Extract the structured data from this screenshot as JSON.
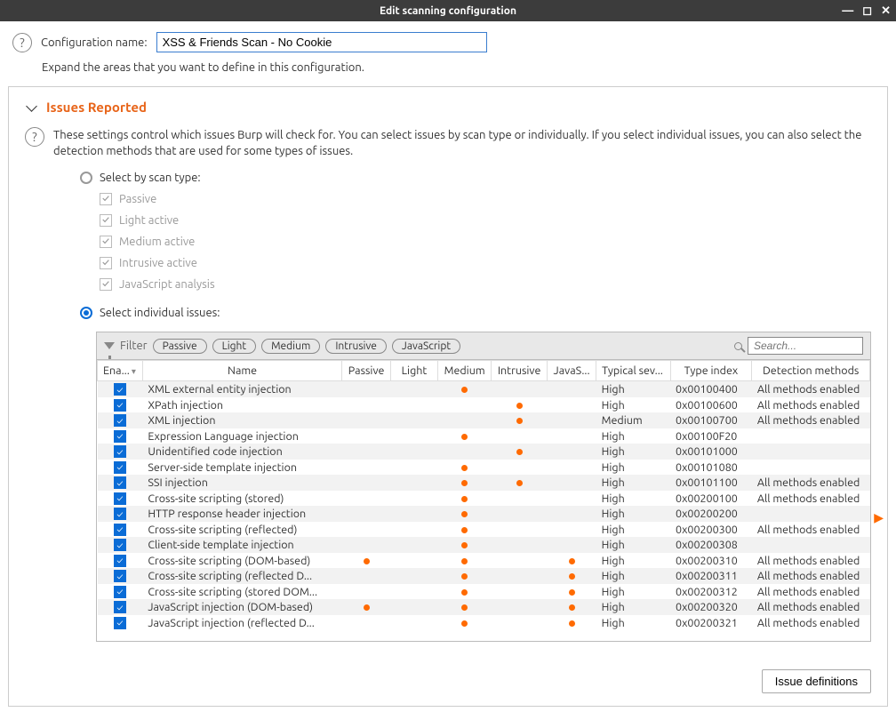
{
  "window": {
    "title": "Edit scanning configuration"
  },
  "header": {
    "config_name_label": "Configuration name:",
    "config_name_value": "XSS & Friends Scan - No Cookie",
    "expand_hint": "Expand the areas that you want to define in this configuration."
  },
  "section": {
    "title": "Issues Reported",
    "description": "These settings control which issues Burp will check for. You can select issues by scan type or individually. If you select individual issues, you can also select the detection methods that are used for some types of issues.",
    "select_by_scan_type_label": "Select by scan type:",
    "select_individual_label": "Select individual issues:",
    "scan_type_options": {
      "passive": "Passive",
      "light_active": "Light active",
      "medium_active": "Medium active",
      "intrusive_active": "Intrusive active",
      "javascript_analysis": "JavaScript analysis"
    }
  },
  "filter": {
    "label": "Filter",
    "pills": {
      "passive": "Passive",
      "light": "Light",
      "medium": "Medium",
      "intrusive": "Intrusive",
      "javascript": "JavaScript"
    },
    "search_placeholder": "Search..."
  },
  "table": {
    "headers": {
      "enabled": "Ena...",
      "name": "Name",
      "passive": "Passive",
      "light": "Light",
      "medium": "Medium",
      "intrusive": "Intrusive",
      "javas": "JavaS...",
      "typical_sev": "Typical sev...",
      "type_index": "Type index",
      "detection_methods": "Detection methods"
    },
    "rows": [
      {
        "enabled": true,
        "name": "XML external entity injection",
        "medium": true,
        "sev": "High",
        "typeidx": "0x00100400",
        "methods": "All methods enabled"
      },
      {
        "enabled": true,
        "name": "XPath injection",
        "intrusive": true,
        "sev": "High",
        "typeidx": "0x00100600",
        "methods": "All methods enabled"
      },
      {
        "enabled": true,
        "name": "XML injection",
        "intrusive": true,
        "sev": "Medium",
        "typeidx": "0x00100700",
        "methods": "All methods enabled"
      },
      {
        "enabled": true,
        "name": "Expression Language injection",
        "medium": true,
        "sev": "High",
        "typeidx": "0x00100F20",
        "methods": ""
      },
      {
        "enabled": true,
        "name": "Unidentified code injection",
        "intrusive": true,
        "sev": "High",
        "typeidx": "0x00101000",
        "methods": ""
      },
      {
        "enabled": true,
        "name": "Server-side template injection",
        "medium": true,
        "sev": "High",
        "typeidx": "0x00101080",
        "methods": ""
      },
      {
        "enabled": true,
        "name": "SSI injection",
        "medium": true,
        "intrusive": true,
        "sev": "High",
        "typeidx": "0x00101100",
        "methods": "All methods enabled"
      },
      {
        "enabled": true,
        "name": "Cross-site scripting (stored)",
        "medium": true,
        "sev": "High",
        "typeidx": "0x00200100",
        "methods": "All methods enabled"
      },
      {
        "enabled": true,
        "name": "HTTP response header injection",
        "medium": true,
        "sev": "High",
        "typeidx": "0x00200200",
        "methods": ""
      },
      {
        "enabled": true,
        "name": "Cross-site scripting (reflected)",
        "medium": true,
        "sev": "High",
        "typeidx": "0x00200300",
        "methods": "All methods enabled"
      },
      {
        "enabled": true,
        "name": "Client-side template injection",
        "medium": true,
        "sev": "High",
        "typeidx": "0x00200308",
        "methods": ""
      },
      {
        "enabled": true,
        "name": "Cross-site scripting (DOM-based)",
        "passive": true,
        "medium": true,
        "javas": true,
        "sev": "High",
        "typeidx": "0x00200310",
        "methods": "All methods enabled"
      },
      {
        "enabled": true,
        "name": "Cross-site scripting (reflected D...",
        "medium": true,
        "javas": true,
        "sev": "High",
        "typeidx": "0x00200311",
        "methods": "All methods enabled"
      },
      {
        "enabled": true,
        "name": "Cross-site scripting (stored DOM...",
        "medium": true,
        "javas": true,
        "sev": "High",
        "typeidx": "0x00200312",
        "methods": "All methods enabled"
      },
      {
        "enabled": true,
        "name": "JavaScript injection (DOM-based)",
        "passive": true,
        "medium": true,
        "javas": true,
        "sev": "High",
        "typeidx": "0x00200320",
        "methods": "All methods enabled"
      },
      {
        "enabled": true,
        "name": "JavaScript injection (reflected D...",
        "medium": true,
        "javas": true,
        "sev": "High",
        "typeidx": "0x00200321",
        "methods": "All methods enabled"
      }
    ]
  },
  "buttons": {
    "issue_definitions": "Issue definitions"
  }
}
